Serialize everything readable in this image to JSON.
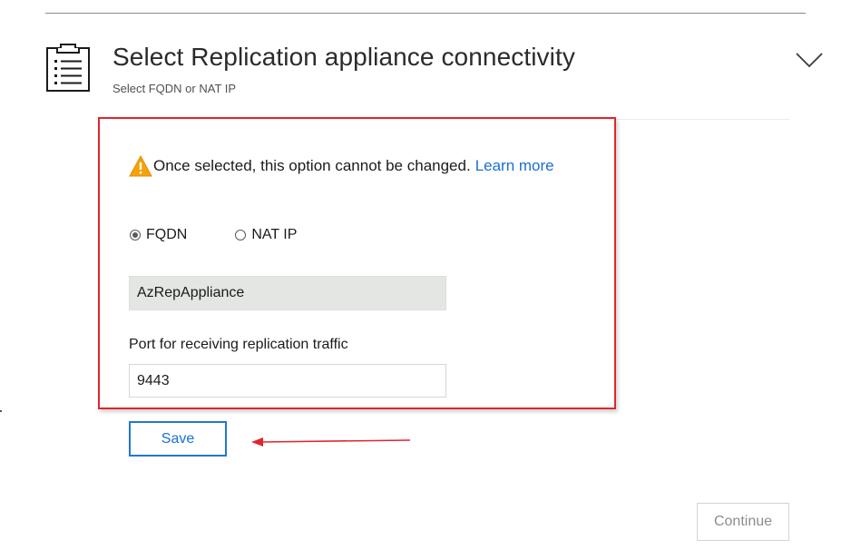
{
  "header": {
    "title": "Select Replication appliance connectivity",
    "subtitle": "Select FQDN or NAT IP",
    "icon": "clipboard-list-icon",
    "expand_icon": "chevron-down-icon"
  },
  "warning": {
    "icon": "warning-triangle-icon",
    "text": "Once selected, this option cannot be changed.",
    "link_text": "Learn more"
  },
  "connectivity": {
    "options": [
      {
        "label": "FQDN",
        "checked": true
      },
      {
        "label": "NAT IP",
        "checked": false
      }
    ],
    "fqdn_value": "AzRepAppliance"
  },
  "port": {
    "label": "Port for receiving replication traffic",
    "value": "9443"
  },
  "actions": {
    "save_label": "Save",
    "continue_label": "Continue"
  },
  "colors": {
    "highlight_border": "#e0262b",
    "accent": "#1a6fd3",
    "warning": "#f2a20c",
    "annotation_arrow": "#e0262b"
  }
}
